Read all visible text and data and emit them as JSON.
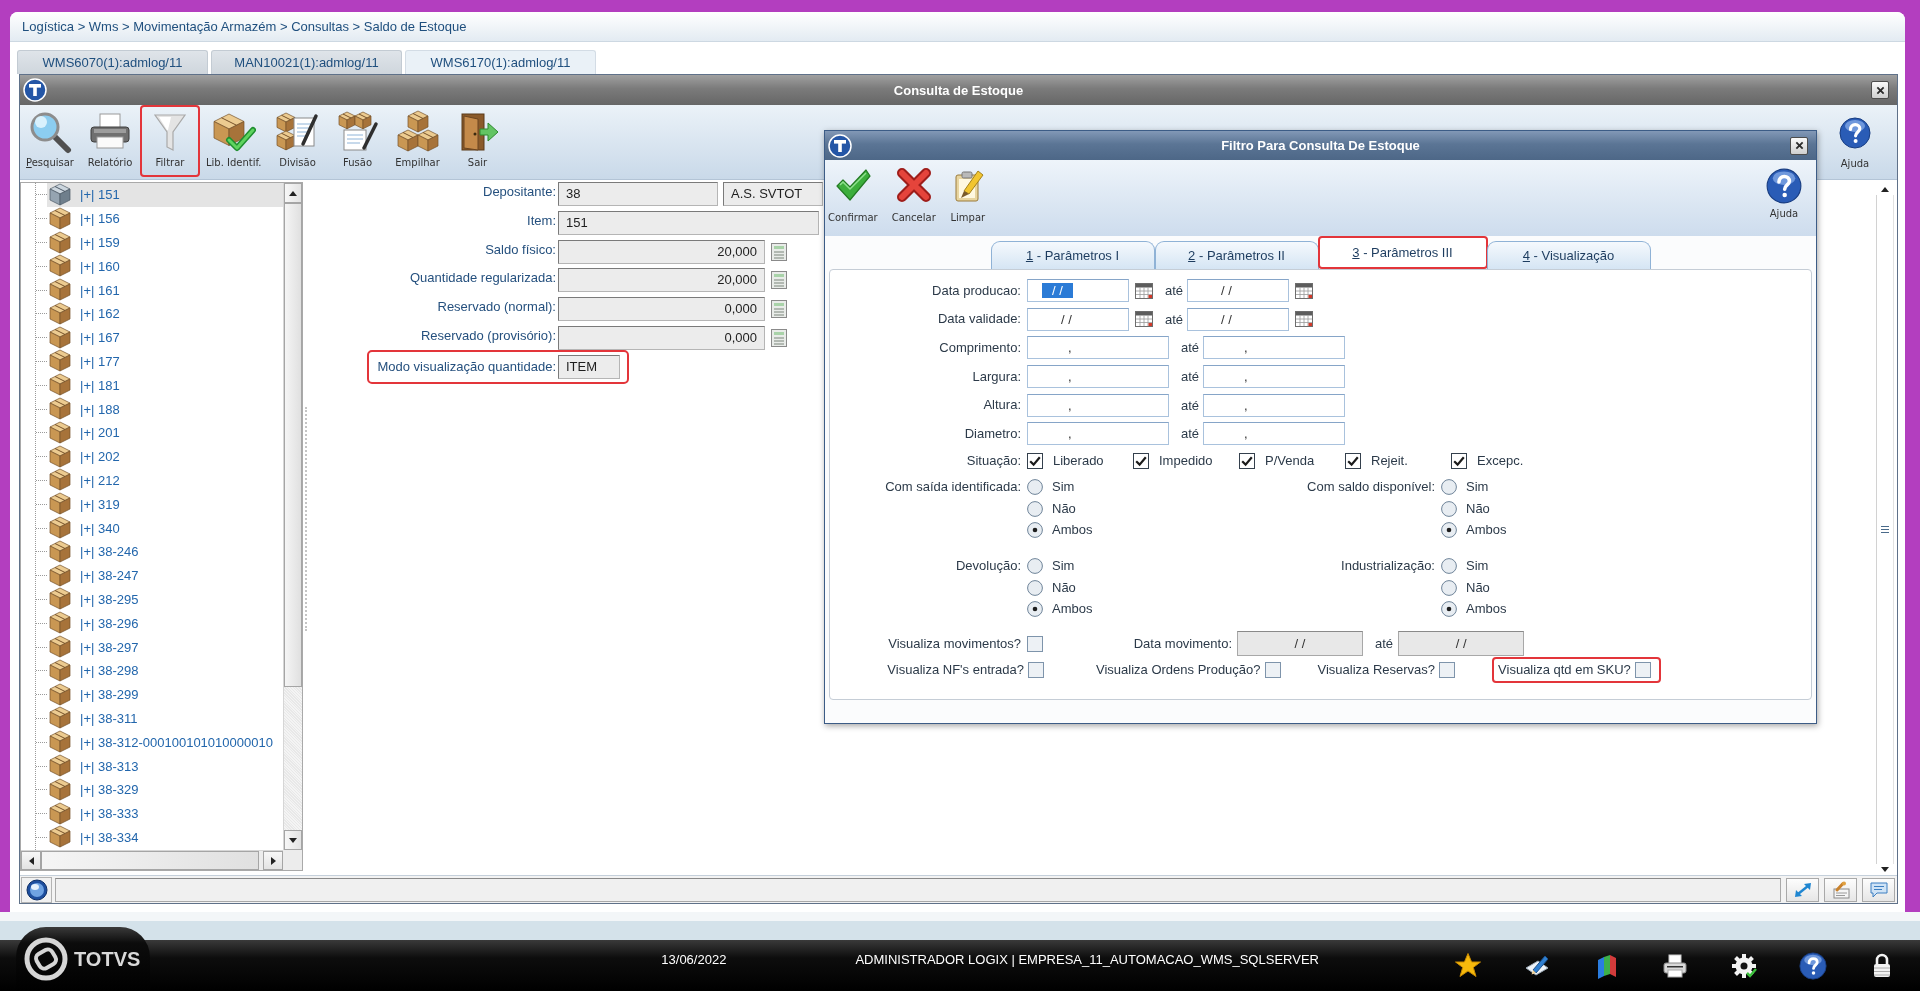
{
  "breadcrumb": "Logística > Wms > Movimentação Armazém > Consultas > Saldo de Estoque",
  "tabs": [
    {
      "label": "WMS6070(1):admlog/11",
      "selected": false
    },
    {
      "label": "MAN10021(1):admlog/11",
      "selected": false
    },
    {
      "label": "WMS6170(1):admlog/11",
      "selected": true
    }
  ],
  "window": {
    "title": "Consulta de Estoque",
    "toolbar": [
      {
        "label": "Pesquisar",
        "kind": "search",
        "hotkey": true,
        "highlighted": false
      },
      {
        "label": "Relatório",
        "kind": "print",
        "hotkey": false,
        "highlighted": false
      },
      {
        "label": "Filtrar",
        "kind": "filter",
        "hotkey": false,
        "highlighted": true
      },
      {
        "label": "Lib. Identif.",
        "kind": "release",
        "hotkey": false,
        "highlighted": false
      },
      {
        "label": "Divisão",
        "kind": "split",
        "hotkey": false,
        "highlighted": false
      },
      {
        "label": "Fusão",
        "kind": "merge",
        "hotkey": false,
        "highlighted": false
      },
      {
        "label": "Empilhar",
        "kind": "stack",
        "hotkey": false,
        "highlighted": false
      },
      {
        "label": "Sair",
        "kind": "exit",
        "hotkey": false,
        "highlighted": false
      }
    ],
    "help": "Ajuda",
    "tree": [
      {
        "label": "|+| 151",
        "selected": true
      },
      {
        "label": "|+| 156",
        "selected": false
      },
      {
        "label": "|+| 159",
        "selected": false
      },
      {
        "label": "|+| 160",
        "selected": false
      },
      {
        "label": "|+| 161",
        "selected": false
      },
      {
        "label": "|+| 162",
        "selected": false
      },
      {
        "label": "|+| 167",
        "selected": false
      },
      {
        "label": "|+| 177",
        "selected": false
      },
      {
        "label": "|+| 181",
        "selected": false
      },
      {
        "label": "|+| 188",
        "selected": false
      },
      {
        "label": "|+| 201",
        "selected": false
      },
      {
        "label": "|+| 202",
        "selected": false
      },
      {
        "label": "|+| 212",
        "selected": false
      },
      {
        "label": "|+| 319",
        "selected": false
      },
      {
        "label": "|+| 340",
        "selected": false
      },
      {
        "label": "|+| 38-246",
        "selected": false
      },
      {
        "label": "|+| 38-247",
        "selected": false
      },
      {
        "label": "|+| 38-295",
        "selected": false
      },
      {
        "label": "|+| 38-296",
        "selected": false
      },
      {
        "label": "|+| 38-297",
        "selected": false
      },
      {
        "label": "|+| 38-298",
        "selected": false
      },
      {
        "label": "|+| 38-299",
        "selected": false
      },
      {
        "label": "|+| 38-311",
        "selected": false
      },
      {
        "label": "|+| 38-312-000100101010000010",
        "selected": false
      },
      {
        "label": "|+| 38-313",
        "selected": false
      },
      {
        "label": "|+| 38-329",
        "selected": false
      },
      {
        "label": "|+| 38-333",
        "selected": false
      },
      {
        "label": "|+| 38-334",
        "selected": false
      }
    ],
    "fields": [
      {
        "label": "Depositante:",
        "kind": "pair",
        "values": [
          "38",
          "A.S. SVTOT"
        ],
        "highlighted": false
      },
      {
        "label": "Item:",
        "kind": "text",
        "values": [
          "151"
        ],
        "highlighted": false
      },
      {
        "label": "Saldo físico:",
        "kind": "quantity",
        "values": [
          "20,000"
        ],
        "highlighted": false
      },
      {
        "label": "Quantidade regularizada:",
        "kind": "quantity",
        "values": [
          "20,000"
        ],
        "highlighted": false
      },
      {
        "label": "Reservado (normal):",
        "kind": "quantity",
        "values": [
          "0,000"
        ],
        "highlighted": false
      },
      {
        "label": "Reservado (provisório):",
        "kind": "quantity",
        "values": [
          "0,000"
        ],
        "highlighted": false
      },
      {
        "label": "Modo visualização quantidade:",
        "kind": "short",
        "values": [
          "ITEM"
        ],
        "highlighted": true
      }
    ]
  },
  "dialog": {
    "title": "Filtro Para Consulta De Estoque",
    "toolbar": [
      {
        "label": "Confirmar",
        "kind": "confirm"
      },
      {
        "label": "Cancelar",
        "kind": "cancel"
      },
      {
        "label": "Limpar",
        "kind": "clear"
      }
    ],
    "help": "Ajuda",
    "tabs": [
      {
        "label": "1 - Parâmetros I",
        "selected": false,
        "highlighted": false
      },
      {
        "label": "2 - Parâmetros II",
        "selected": false,
        "highlighted": false
      },
      {
        "label": "3 - Parâmetros III",
        "selected": true,
        "highlighted": true
      },
      {
        "label": "4 - Visualização",
        "selected": false,
        "highlighted": false
      }
    ],
    "ranges": [
      {
        "label": "Data producao:",
        "kind": "date",
        "from": "/ /",
        "from_selected": true,
        "separator": "até",
        "to": "/ /"
      },
      {
        "label": "Data validade:",
        "kind": "date",
        "from": "/ /",
        "from_selected": false,
        "separator": "até",
        "to": "/ /"
      },
      {
        "label": "Comprimento:",
        "kind": "measure",
        "from": ",",
        "from_selected": false,
        "separator": "até",
        "to": ","
      },
      {
        "label": "Largura:",
        "kind": "measure",
        "from": ",",
        "from_selected": false,
        "separator": "até",
        "to": ","
      },
      {
        "label": "Altura:",
        "kind": "measure",
        "from": ",",
        "from_selected": false,
        "separator": "até",
        "to": ","
      },
      {
        "label": "Diametro:",
        "kind": "measure",
        "from": ",",
        "from_selected": false,
        "separator": "até",
        "to": ","
      }
    ],
    "situation": {
      "label": "Situação:",
      "options": [
        {
          "label": "Liberado",
          "checked": true
        },
        {
          "label": "Impedido",
          "checked": true
        },
        {
          "label": "P/Venda",
          "checked": true
        },
        {
          "label": "Rejeit.",
          "checked": true
        },
        {
          "label": "Excepc.",
          "checked": true
        }
      ]
    },
    "radio_groups": [
      {
        "label": "Com saída identificada:",
        "options": [
          {
            "label": "Sim",
            "selected": false
          },
          {
            "label": "Não",
            "selected": false
          },
          {
            "label": "Ambos",
            "selected": true
          }
        ]
      },
      {
        "label": "Com saldo disponível:",
        "options": [
          {
            "label": "Sim",
            "selected": false
          },
          {
            "label": "Não",
            "selected": false
          },
          {
            "label": "Ambos",
            "selected": true
          }
        ]
      },
      {
        "label": "Devolução:",
        "options": [
          {
            "label": "Sim",
            "selected": false
          },
          {
            "label": "Não",
            "selected": false
          },
          {
            "label": "Ambos",
            "selected": true
          }
        ]
      },
      {
        "label": "Industrialização:",
        "options": [
          {
            "label": "Sim",
            "selected": false
          },
          {
            "label": "Não",
            "selected": false
          },
          {
            "label": "Ambos",
            "selected": true
          }
        ]
      }
    ],
    "movements": {
      "label": "Visualiza movimentos?",
      "checked": false,
      "date_label": "Data movimento:",
      "from": "/ /",
      "separator": "até",
      "to": "/ /",
      "disabled": true
    },
    "view_checks": [
      {
        "label": "Visualiza NF's entrada?",
        "checked": false,
        "highlighted": false
      },
      {
        "label": "Visualiza Ordens Produção?",
        "checked": false,
        "highlighted": false
      },
      {
        "label": "Visualiza Reservas?",
        "checked": false,
        "highlighted": false
      },
      {
        "label": "Visualiza qtd em SKU?",
        "checked": false,
        "highlighted": true
      }
    ]
  },
  "taskbar": {
    "logo": "TOTVS",
    "date": "13/06/2022",
    "session": "ADMINISTRADOR LOGIX | EMPRESA_11_AUTOMACAO_WMS_SQLSERVER"
  }
}
